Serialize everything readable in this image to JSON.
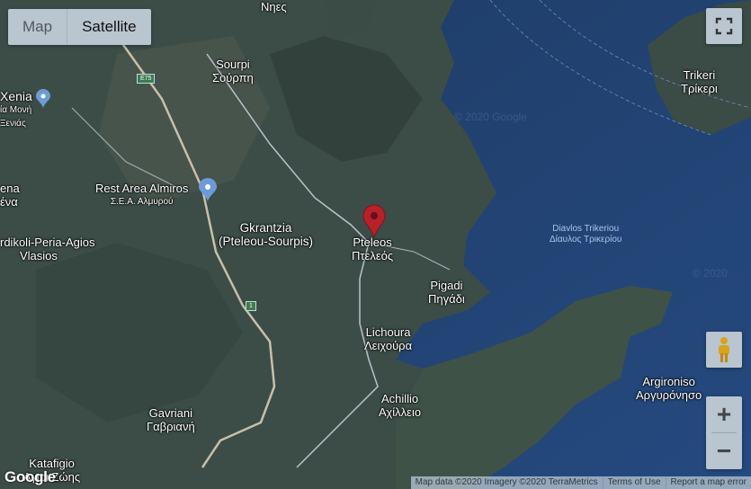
{
  "map_type": {
    "map": "Map",
    "satellite": "Satellite",
    "selected": "Satellite"
  },
  "labels": {
    "nies": "Νηες",
    "sourpi": "Sourpi",
    "sourpi_gr": "Σούρπη",
    "xenia": "Xenia",
    "xenia_gr1": "ία Μονή",
    "xenia_gr2": "Ξενιάς",
    "rest_area": "Rest Area Almiros",
    "rest_area_gr": "Σ.Ε.Α. Αλμυρού",
    "ena": "ena",
    "ena_gr": "ένα",
    "gkrantzia": "Gkrantzia",
    "gkrantzia_sub": "(Pteleou-Sourpis)",
    "kerdikoli": "rdikoli-Peria-Agios",
    "vlasios": "Vlasios",
    "pteleos": "Pteleos",
    "pteleos_gr": "Πτελεός",
    "pigadi": "Pigadi",
    "pigadi_gr": "Πηγάδι",
    "lichoura": "Lichoura",
    "lichoura_gr": "Λειχούρα",
    "achillio": "Achillio",
    "achillio_gr": "Αχίλλειο",
    "gavriani": "Gavriani",
    "gavriani_gr": "Γαβριανή",
    "katafigio": "Katafigio",
    "katafigio_gr": "Αγιοι Ζώης",
    "trikeri": "Trikeri",
    "trikeri_gr": "Τρίκερι",
    "diavlos": "Diavlos Trikeriou",
    "diavlos_gr": "Δίαυλος Τρικερίου",
    "argironiso": "Argironiso",
    "argironiso_gr": "Αργυρόνησο"
  },
  "road_shields": {
    "e75": "E75",
    "route1": "1"
  },
  "icons": {
    "fullscreen": "fullscreen-icon",
    "pegman": "pegman-icon",
    "zoom_in": "+",
    "zoom_out": "−",
    "marker": "map-marker-icon"
  },
  "attribution": {
    "data": "Map data ©2020 Imagery ©2020 TerraMetrics",
    "terms": "Terms of Use",
    "report": "Report a map error"
  },
  "logo": "Google",
  "colors": {
    "sea": "#1f3f70",
    "land": "#3a4c47",
    "marker": "#b8202a"
  }
}
